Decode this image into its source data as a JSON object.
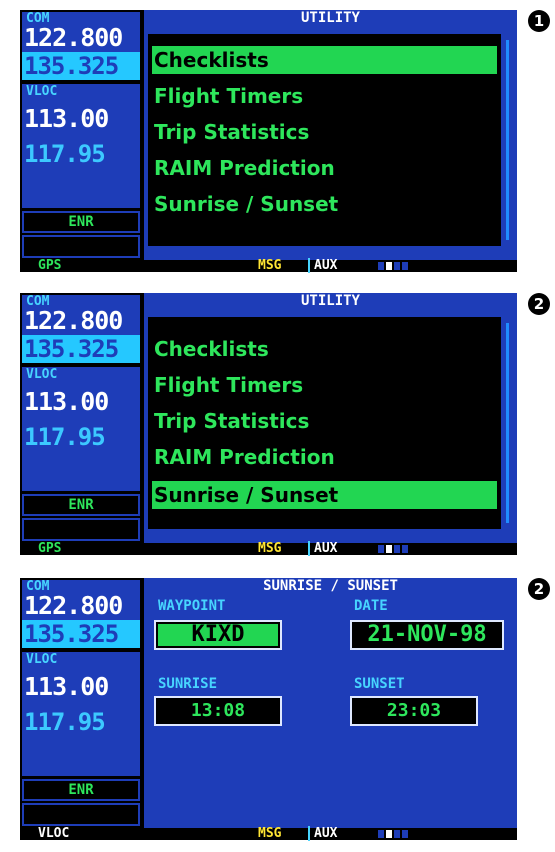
{
  "steps": [
    "1",
    "2",
    "2"
  ],
  "frequencies": {
    "com_label": "COM",
    "com_active": "122.800",
    "com_standby": "135.325",
    "vloc_label": "VLOC",
    "vloc_active": "113.00",
    "vloc_standby": "117.95",
    "mode": "ENR"
  },
  "utility": {
    "title": "UTILITY",
    "items": [
      "Checklists",
      "Flight Timers",
      "Trip Statistics",
      "RAIM Prediction",
      "Sunrise / Sunset"
    ]
  },
  "sunrise_page": {
    "title": "SUNRISE / SUNSET",
    "waypoint_label": "WAYPOINT",
    "waypoint_value": "KIXD",
    "date_label": "DATE",
    "date_value": "21-NOV-98",
    "sunrise_label": "SUNRISE",
    "sunrise_value": "13:08",
    "sunset_label": "SUNSET",
    "sunset_value": "23:03"
  },
  "status_bar": {
    "nav_mode_1": "GPS",
    "nav_mode_2": "GPS",
    "nav_mode_3": "VLOC",
    "msg": "MSG",
    "aux": "AUX"
  },
  "colors": {
    "screen_blue": "#1e3db8",
    "text_green": "#2ee65c",
    "label_cyan": "#47d4ff",
    "msg_yellow": "#ffe534"
  }
}
